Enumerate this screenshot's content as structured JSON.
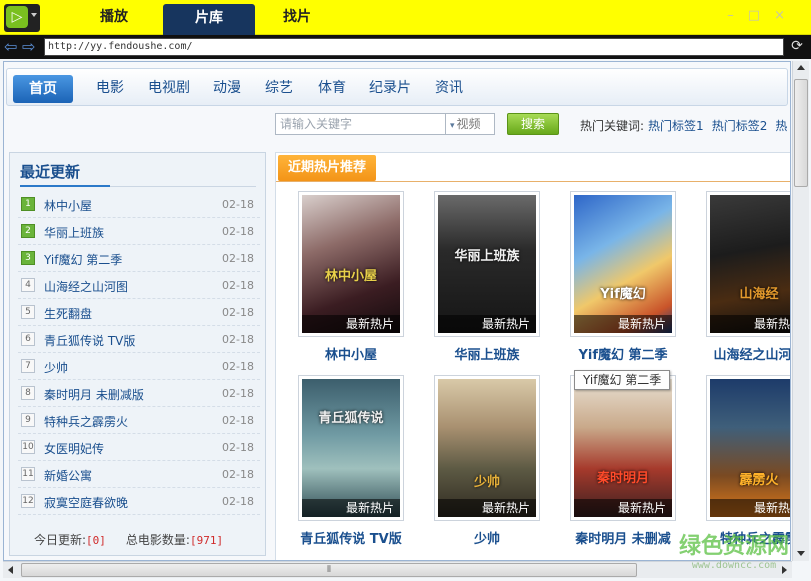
{
  "titlebar": {
    "tabs": [
      {
        "label": "播放"
      },
      {
        "label": "片库"
      },
      {
        "label": "找片"
      }
    ]
  },
  "address": {
    "url": "http://yy.fendoushe.com/"
  },
  "categories": {
    "home": "首页",
    "items": [
      "电影",
      "电视剧",
      "动漫",
      "综艺",
      "体育",
      "纪录片",
      "资讯"
    ]
  },
  "search": {
    "placeholder": "请输入关键字",
    "type": "视频",
    "button": "搜索",
    "hot_label": "热门关键词:",
    "hot_tags": [
      "热门标签1",
      "热门标签2",
      "热"
    ]
  },
  "latest": {
    "title": "最近更新",
    "items": [
      {
        "num": "1",
        "name": "林中小屋",
        "date": "02-18"
      },
      {
        "num": "2",
        "name": "华丽上班族",
        "date": "02-18"
      },
      {
        "num": "3",
        "name": "Yif魔幻 第二季",
        "date": "02-18"
      },
      {
        "num": "4",
        "name": "山海经之山河图",
        "date": "02-18"
      },
      {
        "num": "5",
        "name": "生死翻盘",
        "date": "02-18"
      },
      {
        "num": "6",
        "name": "青丘狐传说 TV版",
        "date": "02-18"
      },
      {
        "num": "7",
        "name": "少帅",
        "date": "02-18"
      },
      {
        "num": "8",
        "name": "秦时明月 未删减版",
        "date": "02-18"
      },
      {
        "num": "9",
        "name": "特种兵之霹雳火",
        "date": "02-18"
      },
      {
        "num": "10",
        "name": "女医明妃传",
        "date": "02-18"
      },
      {
        "num": "11",
        "name": "新婚公寓",
        "date": "02-18"
      },
      {
        "num": "12",
        "name": "寂寞空庭春欲晚",
        "date": "02-18"
      }
    ],
    "footer_today_label": "今日更新:",
    "footer_today_value": "[0]",
    "footer_total_label": "总电影数量:",
    "footer_total_value": "[971]"
  },
  "recommend": {
    "title": "近期热片推荐",
    "badge": "最新热片",
    "cards": [
      {
        "name": "林中小屋",
        "poster_text": "林中小屋"
      },
      {
        "name": "华丽上班族",
        "poster_text": "华丽上班族"
      },
      {
        "name": "Yif魔幻 第二季",
        "poster_text": "Yif魔幻"
      },
      {
        "name": "山海经之山河图",
        "poster_text": "山海经"
      },
      {
        "name": "青丘狐传说 TV版",
        "poster_text": "青丘狐传说"
      },
      {
        "name": "少帅",
        "poster_text": "少帅"
      },
      {
        "name": "秦时明月 未删减",
        "poster_text": "秦时明月"
      },
      {
        "name": "特种兵之霹雳",
        "poster_text": "霹雳火"
      }
    ]
  },
  "tooltip": "Yif魔幻 第二季",
  "watermark": {
    "main": "绿色资源网",
    "sub": "www.downcc.com"
  },
  "colors": {
    "titlebar": "#ffff00",
    "active_tab": "#17355e",
    "link": "#1a4f8e",
    "accent_orange": "#f39417",
    "search_green": "#67a81a"
  }
}
